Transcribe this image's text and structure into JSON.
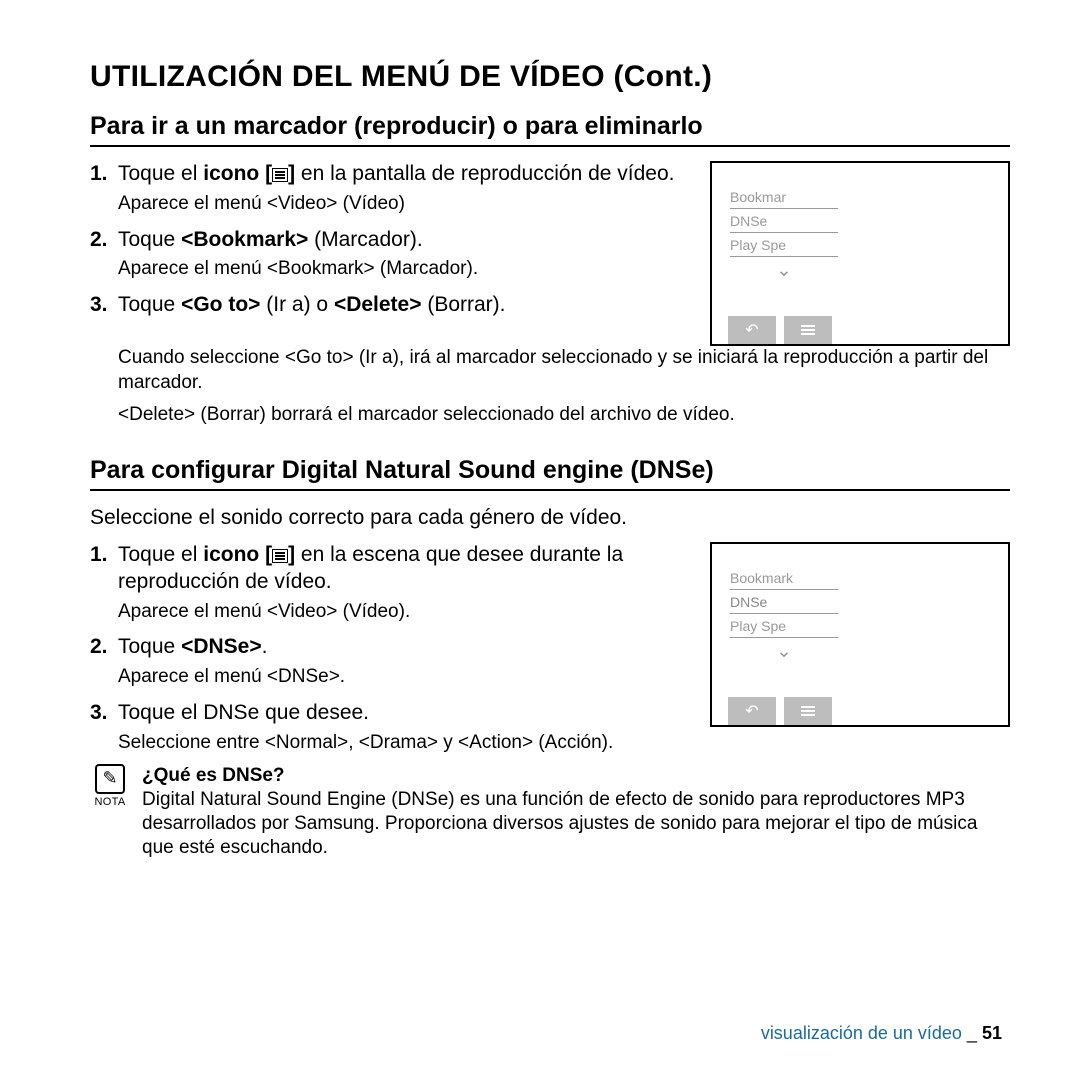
{
  "title": "UTILIZACIÓN DEL MENÚ DE VÍDEO (Cont.)",
  "sec1": {
    "heading": "Para ir a un marcador (reproducir) o para eliminarlo",
    "step1_pre": "Toque el ",
    "step1_bold": "icono [",
    "step1_post": "] ",
    "step1_cont": "en la pantalla de reproducción de vídeo.",
    "step1_sub": "Aparece el menú <Video> (Vídeo)",
    "step2_pre": "Toque ",
    "step2_bold": "<Bookmark>",
    "step2_post": " (Marcador).",
    "step2_sub": "Aparece el menú <Bookmark> (Marcador).",
    "step3_pre": "Toque ",
    "step3_b1": "<Go to>",
    "step3_mid": " (Ir a) o ",
    "step3_b2": "<Delete>",
    "step3_post": " (Borrar).",
    "step3_sub1": "Cuando seleccione <Go to> (Ir a), irá al marcador seleccionado y se iniciará la reproducción a partir del marcador.",
    "step3_sub2": "<Delete> (Borrar) borrará el marcador seleccionado del archivo de vídeo.",
    "device": {
      "i1": "Bookmar",
      "i2": "DNSe",
      "i3": "Play Spe"
    }
  },
  "sec2": {
    "heading": "Para conﬁgurar Digital Natural Sound engine (DNSe)",
    "intro": "Seleccione el sonido correcto para cada género de vídeo.",
    "step1_pre": "Toque el ",
    "step1_bold": "icono [",
    "step1_post": "] ",
    "step1_cont": "en la escena que desee durante la reproducción de vídeo.",
    "step1_sub": "Aparece el menú <Video> (Vídeo).",
    "step2_pre": "Toque ",
    "step2_bold": "<DNSe>",
    "step2_post": ".",
    "step2_sub": "Aparece el menú <DNSe>.",
    "step3": "Toque el DNSe que desee.",
    "step3_sub": "Seleccione entre <Normal>, <Drama> y <Action> (Acción).",
    "device": {
      "i1": "Bookmark",
      "i2": "DNSe",
      "i3": "Play Spe"
    }
  },
  "note": {
    "label": "NOTA",
    "q": "¿Qué es DNSe?",
    "body": "Digital Natural Sound Engine (DNSe) es una función de efecto de sonido para reproductores MP3 desarrollados por Samsung. Proporciona diversos ajustes de sonido para mejorar el tipo de música que esté escuchando."
  },
  "footer": {
    "section": "visualización de un vídeo",
    "sep": " _ ",
    "page": "51"
  },
  "marks": {
    "n1": "1.",
    "n2": "2.",
    "n3": "3."
  }
}
